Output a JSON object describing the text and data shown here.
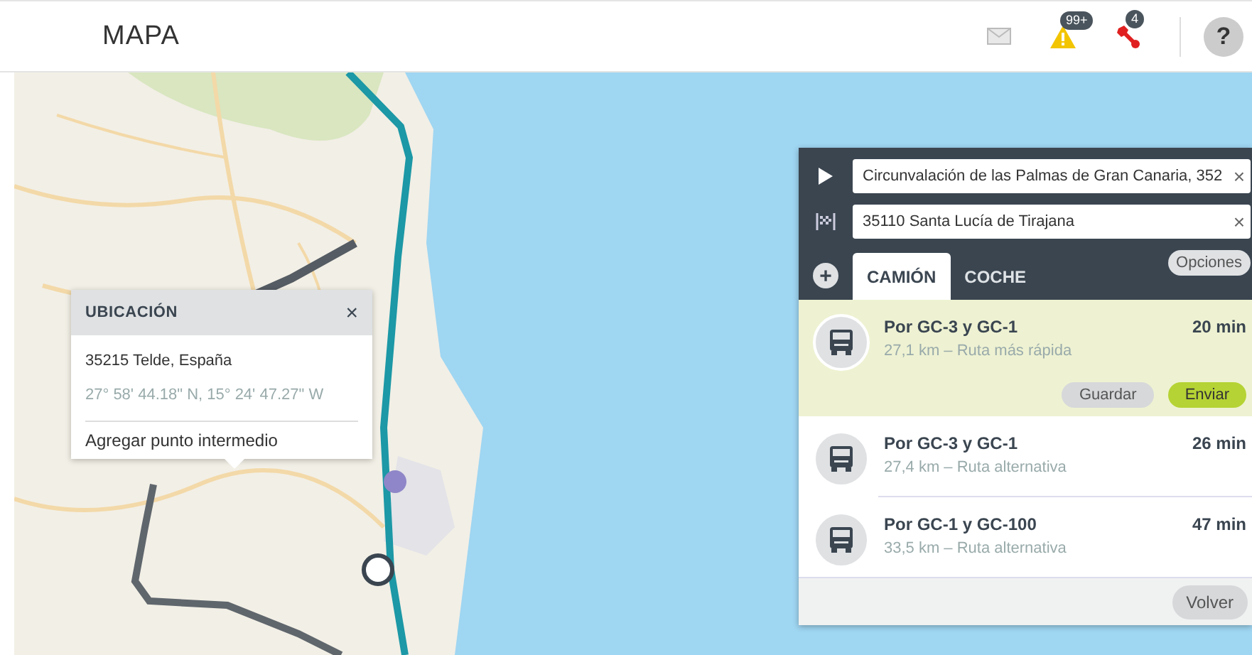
{
  "header": {
    "title": "MAPA",
    "icons": [
      {
        "kind": "mail"
      },
      {
        "kind": "warning",
        "badge": "99+"
      },
      {
        "kind": "wrench",
        "badge": "4"
      }
    ],
    "help": "?"
  },
  "location_popup": {
    "title": "UBICACIÓN",
    "close": "×",
    "address": "35215 Telde, España",
    "coordinates": "27° 58' 44.18\" N, 15° 24' 47.27\" W",
    "action": "Agregar punto intermedio"
  },
  "route_panel": {
    "stops": [
      {
        "kind": "start",
        "value": "Circunvalación de las Palmas de Gran Canaria, 352",
        "clear": "×"
      },
      {
        "kind": "finish",
        "value": "35110 Santa Lucía de Tirajana",
        "clear": "×"
      }
    ],
    "add": "+",
    "tabs": [
      {
        "label": "CAMIÓN",
        "selected": true
      },
      {
        "label": "COCHE",
        "selected": false
      }
    ],
    "options": "Opciones",
    "routes": [
      {
        "name": "Por GC-3 y GC-1",
        "detail": "27,1 km – Ruta más rápida",
        "time": "20 min",
        "selected": true
      },
      {
        "name": "Por GC-3 y GC-1",
        "detail": "27,4 km – Ruta alternativa",
        "time": "26 min",
        "selected": false
      },
      {
        "name": "Por GC-1 y GC-100",
        "detail": "33,5 km – Ruta alternativa",
        "time": "47 min",
        "selected": false
      }
    ],
    "actions": [
      "Guardar",
      "Enviar"
    ],
    "back": "Volver"
  }
}
